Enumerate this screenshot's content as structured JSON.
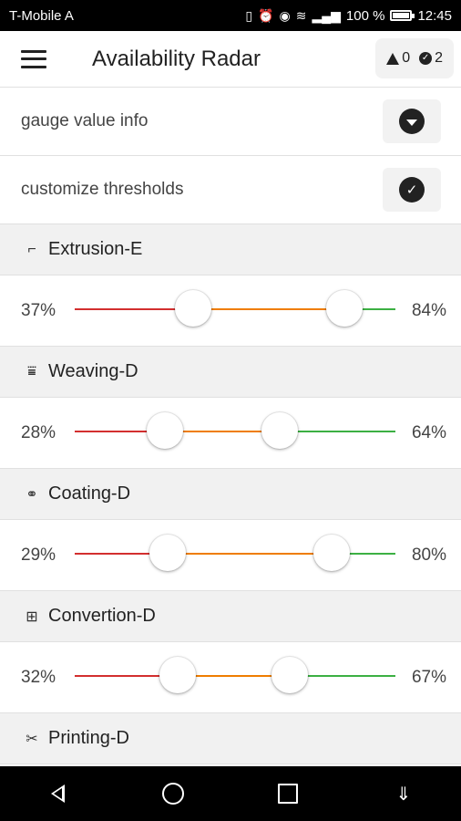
{
  "status_bar": {
    "carrier": "T-Mobile A",
    "battery_text": "100 %",
    "time": "12:45",
    "icons": [
      "vibrate-icon",
      "alarm-icon",
      "eye-icon",
      "wifi-icon",
      "signal-icon",
      "battery-charging-icon"
    ]
  },
  "app_bar": {
    "title": "Availability Radar",
    "warning_count": "0",
    "ok_count": "2"
  },
  "options": [
    {
      "label": "gauge value info",
      "icon": "chevron-down-circle-icon"
    },
    {
      "label": "customize thresholds",
      "icon": "check-circle-icon"
    }
  ],
  "machines": [
    {
      "name": "Extrusion-E",
      "icon": "extrusion-icon",
      "low": "37%",
      "high": "84%",
      "low_value": 37,
      "high_value": 84
    },
    {
      "name": "Weaving-D",
      "icon": "weaving-icon",
      "low": "28%",
      "high": "64%",
      "low_value": 28,
      "high_value": 64
    },
    {
      "name": "Coating-D",
      "icon": "coating-icon",
      "low": "29%",
      "high": "80%",
      "low_value": 29,
      "high_value": 80
    },
    {
      "name": "Convertion-D",
      "icon": "convertion-icon",
      "low": "32%",
      "high": "67%",
      "low_value": 32,
      "high_value": 67
    },
    {
      "name": "Printing-D",
      "icon": "printing-icon"
    }
  ],
  "colors": {
    "low": "#d32f2f",
    "mid": "#ef7d00",
    "high": "#3cb043"
  },
  "nav_bar": {
    "icons": [
      "back-icon",
      "home-icon",
      "recents-icon",
      "notifications-pull-icon"
    ]
  }
}
